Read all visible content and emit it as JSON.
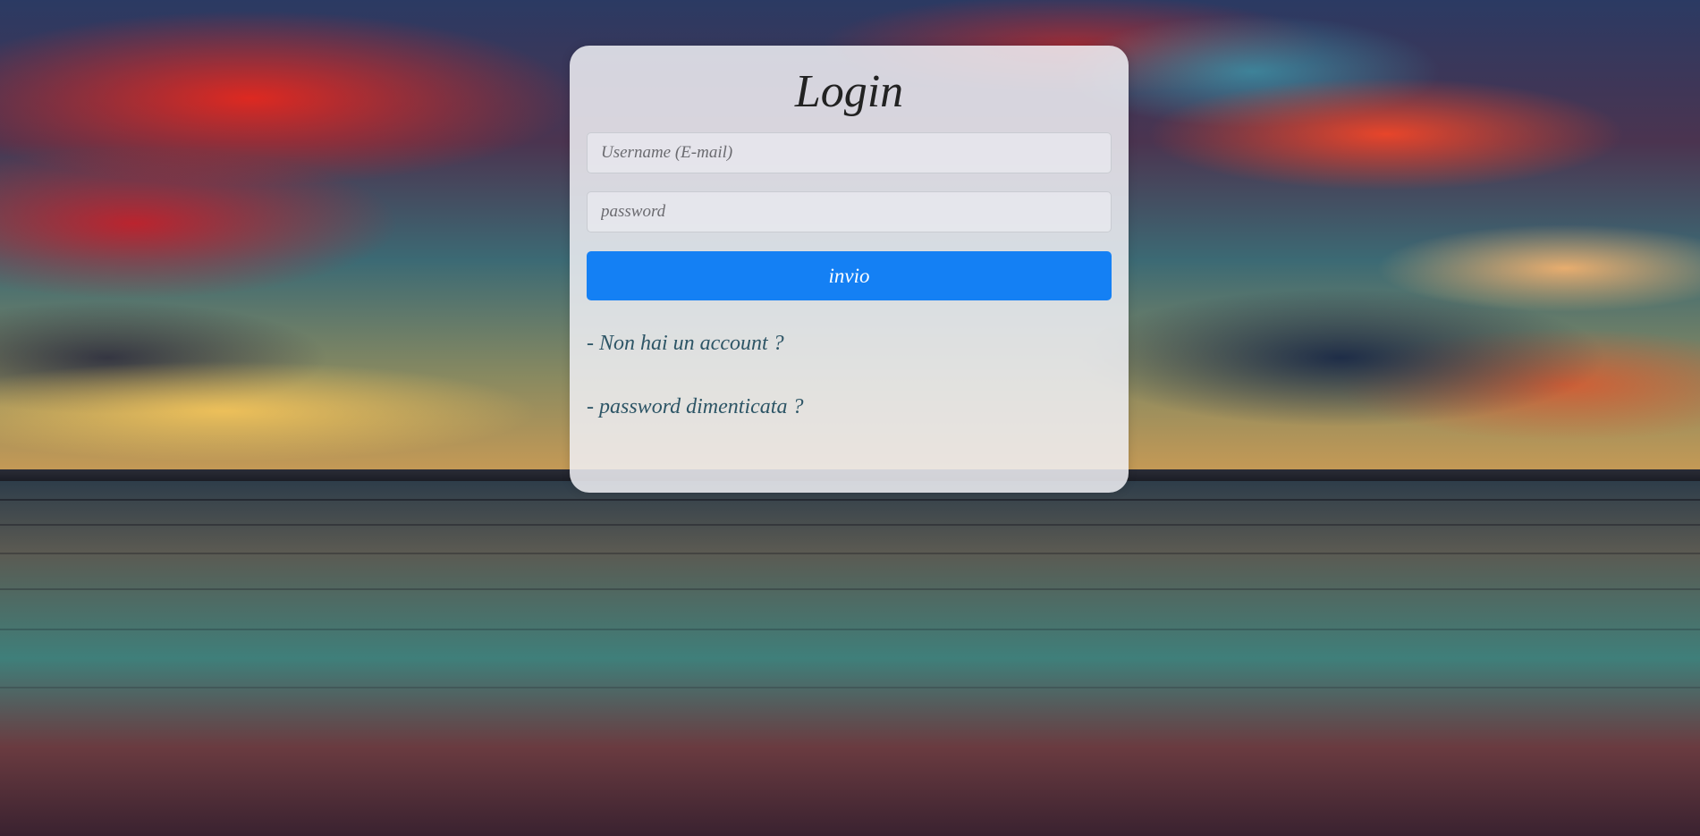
{
  "login": {
    "title": "Login",
    "username_placeholder": "Username (E-mail)",
    "password_placeholder": "password",
    "submit_label": "invio",
    "dash": "-",
    "signup_link": "Non hai un account ?",
    "forgot_link": "password dimenticata ?"
  },
  "colors": {
    "button": "#1480f4",
    "link": "#2d5566",
    "card": "rgba(240,240,245,0.86)"
  }
}
